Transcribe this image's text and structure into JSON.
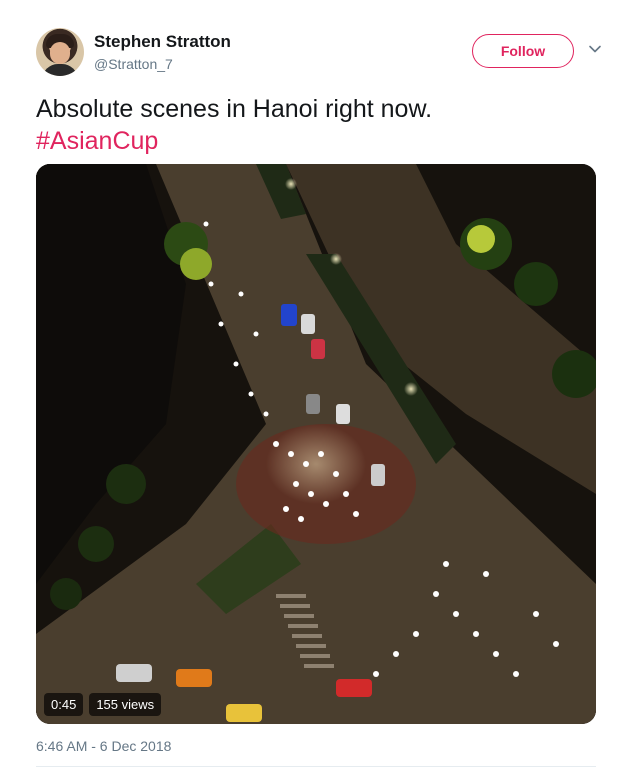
{
  "author": {
    "display_name": "Stephen Stratton",
    "handle": "@Stratton_7"
  },
  "follow_button": {
    "label": "Follow"
  },
  "tweet": {
    "text": "Absolute scenes in Hanoi right now.",
    "hashtag": "#AsianCup"
  },
  "video": {
    "duration": "0:45",
    "views": "155 views"
  },
  "timestamp": "6:46 AM - 6 Dec 2018",
  "colors": {
    "accent": "#e0245e",
    "secondary_text": "#657786"
  },
  "icons": {
    "more": "chevron-down-icon"
  }
}
